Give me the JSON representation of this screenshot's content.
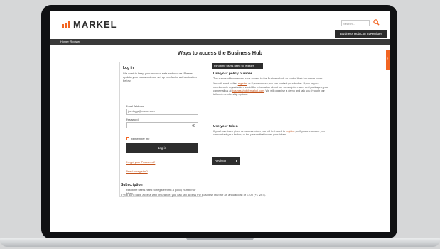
{
  "header": {
    "brand": "MARKEL",
    "search_placeholder": "Search...",
    "login_register": "Business Hub Log In/Register"
  },
  "nav": {
    "breadcrumb": "Home › Register"
  },
  "side_tab": {
    "label": "?"
  },
  "main": {
    "title": "Ways to access the Business Hub"
  },
  "login": {
    "title": "Log in",
    "description": "We want to keep your account safe and secure. Please update your password and set up two-factor authentication below.",
    "email_label": "Email Address",
    "email_value": "joebloggs@markel.com",
    "password_label": "Password",
    "remember": "Remember me",
    "login_button": "Log in",
    "forgot_link": "Forgot your Password?",
    "register_link": "Need to register?",
    "note": "First time users need to register with a policy number or token"
  },
  "access": {
    "first_time_banner": "First time users need to register",
    "policy": {
      "title": "Use your policy number",
      "text1": "Thousands of businesses have access to the Business Hub as part of their insurance cover.",
      "text2_pre": "You will need to first ",
      "text2_link": "register",
      "text2_post": ", or if your unsure you can contact your broker.",
      "text3": "If you or your membership organisation would like information about our subscription rates and packages, you can email us at",
      "email_link": "businesshub@markel.com",
      "text4": ". We will organise a demo and talk you through our tailored membership options."
    },
    "token": {
      "title": "Use your token",
      "text_pre": "If you have been given an access token you will first need to ",
      "text_link": "register",
      "text_post": ", or if you are unsure you can contact your broker, or the person that issues your token."
    },
    "register_button": "Register"
  },
  "subscription": {
    "title": "Subscription",
    "text": "If you don't have access with insurance, you can still access the Business Hub for an annual cost of £100 (+£ VAT)."
  },
  "colors": {
    "accent": "#f26522",
    "dark": "#2d2d2d",
    "lid": "#101113"
  }
}
